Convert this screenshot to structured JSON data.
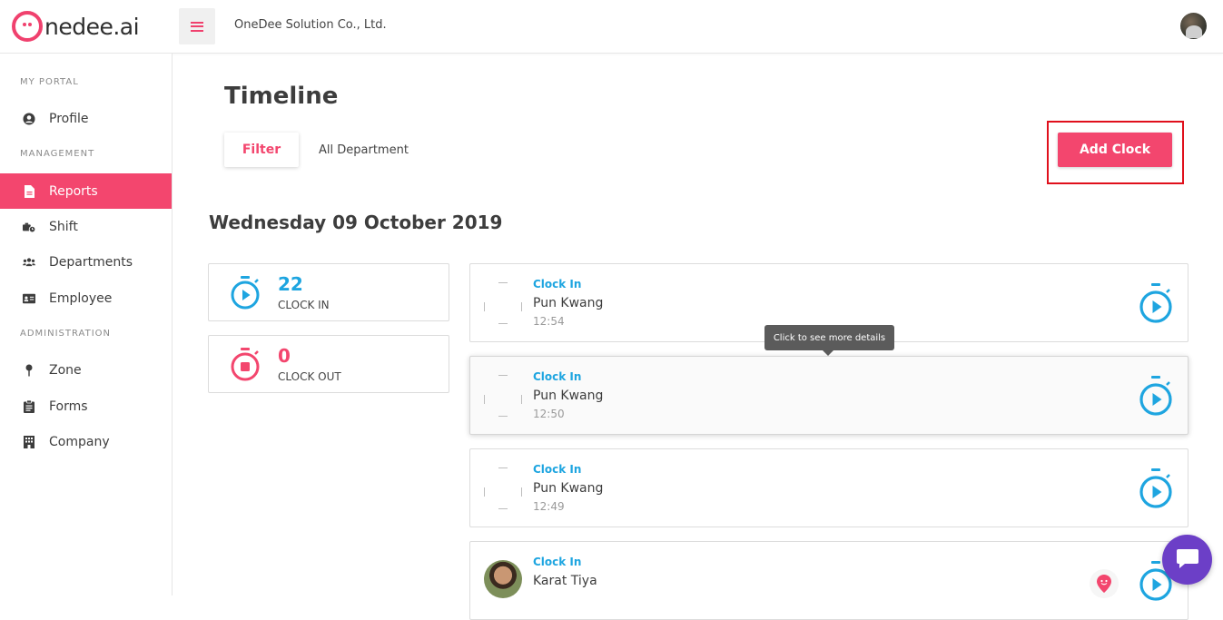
{
  "brand": {
    "logo_text": "nedee.ai",
    "accent": "#f3466e",
    "blue": "#1ea5e0"
  },
  "header": {
    "company": "OneDee Solution Co., Ltd.",
    "menu_icon": "hamburger-icon"
  },
  "sidebar": {
    "sections": [
      {
        "heading": "MY PORTAL",
        "items": [
          {
            "label": "Profile",
            "icon": "user-circle-icon"
          }
        ]
      },
      {
        "heading": "MANAGEMENT",
        "items": [
          {
            "label": "Reports",
            "icon": "file-icon",
            "active": true
          },
          {
            "label": "Shift",
            "icon": "shift-clock-icon"
          },
          {
            "label": "Departments",
            "icon": "users-icon"
          },
          {
            "label": "Employee",
            "icon": "id-card-icon"
          }
        ]
      },
      {
        "heading": "ADMINISTRATION",
        "items": [
          {
            "label": "Zone",
            "icon": "pin-icon"
          },
          {
            "label": "Forms",
            "icon": "clipboard-icon"
          },
          {
            "label": "Company",
            "icon": "building-icon"
          }
        ]
      }
    ]
  },
  "main": {
    "title": "Timeline",
    "filter_label": "Filter",
    "department": "All Department",
    "add_clock_label": "Add Clock",
    "date": "Wednesday 09 October 2019",
    "stats": [
      {
        "value": "22",
        "label": "CLOCK IN",
        "color": "#1ea5e0"
      },
      {
        "value": "0",
        "label": "CLOCK OUT",
        "color": "#f3466e"
      }
    ],
    "tooltip": "Click to see more details",
    "timeline": [
      {
        "type": "Clock In",
        "name": "Pun Kwang",
        "time": "12:54"
      },
      {
        "type": "Clock In",
        "name": "Pun Kwang",
        "time": "12:50"
      },
      {
        "type": "Clock In",
        "name": "Pun Kwang",
        "time": "12:49"
      },
      {
        "type": "Clock In",
        "name": "Karat Tiya",
        "time": ""
      }
    ]
  }
}
